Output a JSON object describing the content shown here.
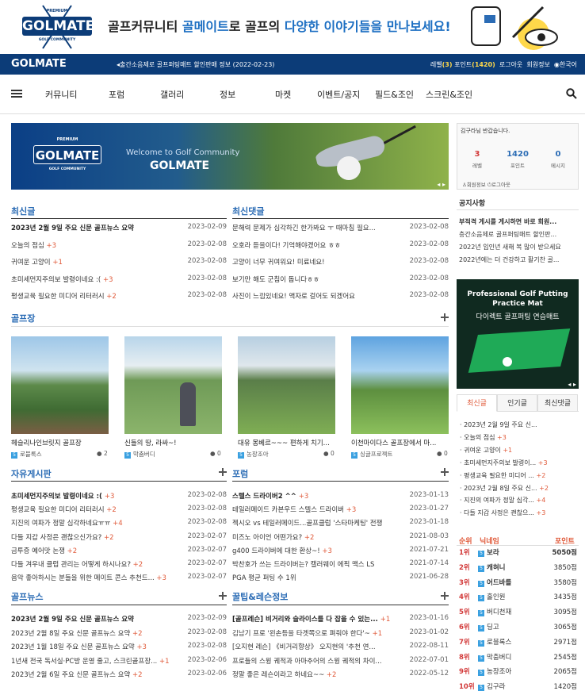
{
  "brand": {
    "logo_text": "GOLMATE",
    "logo_premium": "PREMIUM",
    "logo_sub": "GOLF COMMUNITY"
  },
  "slogan": {
    "part1": "골프커뮤니티 ",
    "hl1": "골메이트",
    "part2": "로 골프의 ",
    "hl2": "다양한 이야기들을 만나보세요!"
  },
  "bar": {
    "logo": "GOLMATE",
    "notice": "출간소음제로 골프퍼팅매트 할인판매 정보 (2022-02-23)",
    "level_label": "레벨",
    "level": "(3)",
    "point_label": "포인트",
    "points": "(1420)",
    "logout": "로그아웃",
    "member_info": "회원정보",
    "language": "한국어"
  },
  "nav": [
    "커뮤니티",
    "포럼",
    "갤러리",
    "정보",
    "마켓",
    "이벤트/공지",
    "필드&조인",
    "스크린&조인"
  ],
  "banner": {
    "welcome": "Welcome to Golf Community",
    "title": "GOLMATE",
    "premium": "PREMIUM",
    "golf_community": "GOLF COMMUNITY"
  },
  "latest_posts": {
    "title": "최신글",
    "items": [
      {
        "title": "2023년 2월 9일 주요 신문 골프뉴스 요약",
        "count": "",
        "date": "2023-02-09",
        "bold": true
      },
      {
        "title": "오늘의 점심 ",
        "count": "+3",
        "date": "2023-02-08",
        "bold": false
      },
      {
        "title": "귀여운 고양이 ",
        "count": "+1",
        "date": "2023-02-08",
        "bold": false
      },
      {
        "title": "초미세먼지주의보 발령이네요 :( ",
        "count": "+3",
        "date": "2023-02-08",
        "bold": false
      },
      {
        "title": "평생교육 필요한 미디어 리터러시 ",
        "count": "+2",
        "date": "2023-02-08",
        "bold": false
      }
    ]
  },
  "latest_comments": {
    "title": "최신댓글",
    "items": [
      {
        "title": "문해력 문제가 심각하긴 한가봐요 ㅜ 때마침 필요...",
        "date": "2023-02-08"
      },
      {
        "title": "오호라 듣을이다! 기억해야겠어요 ㅎㅎ",
        "date": "2023-02-08"
      },
      {
        "title": "고양이 너무 귀여워요! 미료네요!",
        "date": "2023-02-08"
      },
      {
        "title": "보기만 해도 군침이 돕니다ㅎㅎ",
        "date": "2023-02-08"
      },
      {
        "title": "사진이 느낌있네요! 액자로 걸어도 되겠어요",
        "date": "2023-02-08"
      }
    ]
  },
  "golf_courses": {
    "title": "골프장",
    "items": [
      {
        "caption": "헤슬리나인브릿지 골프장",
        "author": "로블록스",
        "comments": "2"
      },
      {
        "caption": "신들의 땅, 라싸~!",
        "author": "막춤버디",
        "comments": "0"
      },
      {
        "caption": "대유 몽베르~~~ 편하게 치기...",
        "author": "농장조아",
        "comments": "0"
      },
      {
        "caption": "이천마이다스 골프장에서 마...",
        "author": "싱글프로젝트",
        "comments": "0"
      }
    ]
  },
  "free_board": {
    "title": "자유게시판",
    "items": [
      {
        "title": "초미세먼지주의보 발령이네요 :( ",
        "count": "+3",
        "date": "2023-02-08",
        "bold": true
      },
      {
        "title": "평생교육 필요한 미디어 리터러시 ",
        "count": "+2",
        "date": "2023-02-08",
        "bold": false
      },
      {
        "title": "지진의 여파가 정말 심각하네요ㅠㅠ ",
        "count": "+4",
        "date": "2023-02-08",
        "bold": false
      },
      {
        "title": "다들 지갑 사정은 괜찮으신가요? ",
        "count": "+2",
        "date": "2023-02-07",
        "bold": false
      },
      {
        "title": "금투증 예어맛 논쟁 ",
        "count": "+2",
        "date": "2023-02-07",
        "bold": false
      },
      {
        "title": "다들 겨우내 클럽 관리는 어떻게 하시나요? ",
        "count": "+2",
        "date": "2023-02-07",
        "bold": false
      },
      {
        "title": "음악 좋아하시는 분들을 위한 메이트 콘스 추천드... ",
        "count": "+3",
        "date": "2023-02-07",
        "bold": false
      }
    ]
  },
  "forum": {
    "title": "포럼",
    "items": [
      {
        "title": "스텔스 드라이버2 ^^ ",
        "count": "+3",
        "date": "2023-01-13",
        "bold": true
      },
      {
        "title": "테일러메이드 카본우드 스텔스 드라이버 ",
        "count": "+3",
        "date": "2023-01-27",
        "bold": false
      },
      {
        "title": "젝시오 vs 테일러메이드...골프클럽 '스타마케팅' 전쟁",
        "count": "",
        "date": "2023-01-18",
        "bold": false
      },
      {
        "title": "미즈노 아이언 어떤가요? ",
        "count": "+2",
        "date": "2021-08-03",
        "bold": false
      },
      {
        "title": "g400 드라이버에 대한 환상~! ",
        "count": "+3",
        "date": "2021-07-21",
        "bold": false
      },
      {
        "title": "박찬호가 쓰는 드라이버는? 캘러웨이 에픽 맥스 LS",
        "count": "",
        "date": "2021-07-14",
        "bold": false
      },
      {
        "title": "PGA 평균 퍼팅 수 1위",
        "count": "",
        "date": "2021-06-28",
        "bold": false
      }
    ]
  },
  "golf_news": {
    "title": "골프뉴스",
    "items": [
      {
        "title": "2023년 2월 9일 주요 신문 골프뉴스 요약",
        "count": "",
        "date": "2023-02-09",
        "bold": true
      },
      {
        "title": "2023년 2월 8일 주요 신문 골프뉴스 요약 ",
        "count": "+2",
        "date": "2023-02-08",
        "bold": false
      },
      {
        "title": "2023년 1월 18일 주요 신문 골프뉴스 요약 ",
        "count": "+3",
        "date": "2023-02-08",
        "bold": false
      },
      {
        "title": "1년새 전국 독서실·PC방 운영 줄고, 스크린골프장... ",
        "count": "+1",
        "date": "2023-02-06",
        "bold": false
      },
      {
        "title": "2023년 2월 6일 주요 신문 골프뉴스 요약 ",
        "count": "+2",
        "date": "2023-02-06",
        "bold": false
      }
    ]
  },
  "tips": {
    "title": "꿀팁&레슨정보",
    "items": [
      {
        "title": "[골프레슨] 비거리와 슬라이스를 다 잡을 수 있는... ",
        "count": "+1",
        "date": "2023-01-16",
        "bold": true
      },
      {
        "title": "김남기 프로 '왼손등을 타겟쪽으로 펴줘야 한다'~ ",
        "count": "+1",
        "date": "2023-01-02",
        "bold": false
      },
      {
        "title": "[오지현 레슨] 《비거리향상》 오지현의 '추천 연...",
        "count": "",
        "date": "2022-08-11",
        "bold": false
      },
      {
        "title": "프로들의 스윙 궤적과 아마추어의 스윙 궤적의 차이...",
        "count": "",
        "date": "2022-07-01",
        "bold": false
      },
      {
        "title": "정말 좋은 레슨이라고 하네요~~ ",
        "count": "+2",
        "date": "2022-05-12",
        "bold": false
      }
    ]
  },
  "login_box": {
    "greeting": "김구라님 반갑습니다.",
    "level": "3",
    "level_label": "레벨",
    "points": "1420",
    "points_label": "포인트",
    "messages": "0",
    "messages_label": "메시지",
    "member_info": "회원정보",
    "logout": "로그아웃"
  },
  "notice_box": {
    "title": "공지사항",
    "items": [
      "부적격 게시를 게시하면 바로 회원...",
      "층간소음제로 골프퍼팅매트 할인판...",
      "2022년 임인년 새해 복 많이 받으세요",
      "2022년에는 더 건강하고 활기찬 골..."
    ]
  },
  "ad": {
    "line1": "Professional Golf Putting",
    "line2": "Practice Mat",
    "line3": "다이렉트 골프퍼팅 연습매트"
  },
  "side_tabs": [
    "최신글",
    "인기글",
    "최신댓글"
  ],
  "side_latest": [
    {
      "title": "2023년 2월 9일 주요 신...",
      "count": ""
    },
    {
      "title": "오늘의 점심 ",
      "count": "+3"
    },
    {
      "title": "귀여운 고양이 ",
      "count": "+1"
    },
    {
      "title": "초미세먼지주의보 발령이... ",
      "count": "+3"
    },
    {
      "title": "평생교육 필요한 미디어 ... ",
      "count": "+2"
    },
    {
      "title": "2023년 2월 8일 주요 신... ",
      "count": "+2"
    },
    {
      "title": "지진의 여파가 정말 심각... ",
      "count": "+4"
    },
    {
      "title": "다들 지갑 사정은 괜찮으... ",
      "count": "+3"
    }
  ],
  "ranking": {
    "head_rank": "순위",
    "head_nick": "닉네임",
    "head_point": "포인트",
    "items": [
      {
        "rank": "1위",
        "nick": "보라",
        "point": "5050점"
      },
      {
        "rank": "2위",
        "nick": "캐혀니",
        "point": "3850점"
      },
      {
        "rank": "3위",
        "nick": "어드바를",
        "point": "3580점"
      },
      {
        "rank": "4위",
        "nick": "홀인원",
        "point": "3435점"
      },
      {
        "rank": "5위",
        "nick": "버디천재",
        "point": "3095점"
      },
      {
        "rank": "6위",
        "nick": "딩고",
        "point": "3065점"
      },
      {
        "rank": "7위",
        "nick": "로블록스",
        "point": "2971점"
      },
      {
        "rank": "8위",
        "nick": "막춤버디",
        "point": "2545점"
      },
      {
        "rank": "9위",
        "nick": "농장조아",
        "point": "2065점"
      },
      {
        "rank": "10위",
        "nick": "김구라",
        "point": "1420점"
      }
    ]
  },
  "colors": {
    "navy": "#0c3c78",
    "accent_blue": "#2b6cb5",
    "comment_red": "#e05a3a"
  }
}
